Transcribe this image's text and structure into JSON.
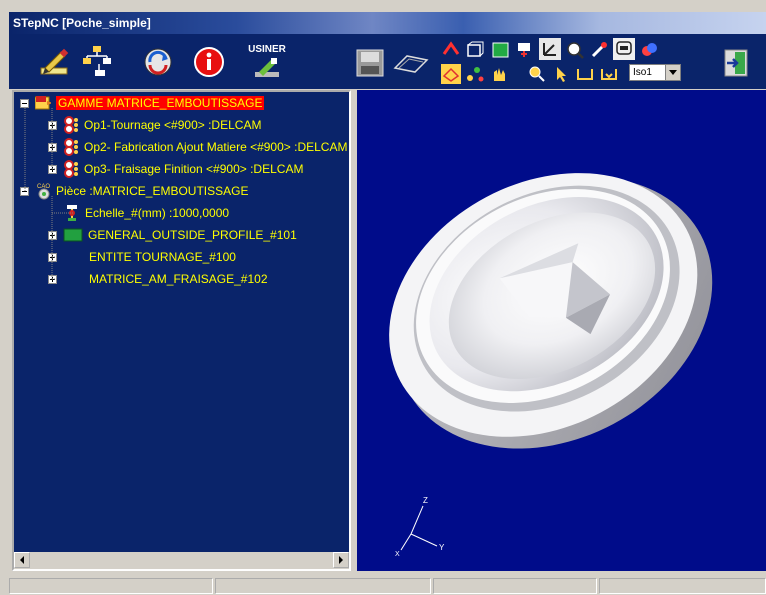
{
  "window": {
    "title": "STepNC [Poche_simple]"
  },
  "toolbar": {
    "usiner_label": "USINER",
    "view_select": {
      "value": "Iso1"
    },
    "icons": [
      "edit-pencil-icon",
      "tree-structure-icon",
      "refresh-icon",
      "info-icon",
      "machine-icon",
      "hard-disk-icon",
      "tool-path-icon",
      "view-rotate-icon",
      "view-zoom-icon",
      "view-fit-icon",
      "view-pan-icon",
      "exit-door-icon"
    ]
  },
  "tree": {
    "items": [
      {
        "label": "GAMME MATRICE_EMBOUTISSAGE",
        "expander": "minus",
        "icon": "stepnc-icon",
        "selected": true
      },
      {
        "label": "Op1-Tournage  <#900> :DELCAM",
        "expander": "plus",
        "icon": "operation-icon"
      },
      {
        "label": "Op2- Fabrication Ajout Matiere  <#900> :DELCAM",
        "expander": "plus",
        "icon": "operation-icon"
      },
      {
        "label": "Op3- Fraisage Finition <#900> :DELCAM",
        "expander": "plus",
        "icon": "operation-icon"
      },
      {
        "label": "Pièce :MATRICE_EMBOUTISSAGE",
        "expander": "minus",
        "icon": "cao-part-icon"
      },
      {
        "label": "Echelle_#(mm) :1000,0000",
        "expander": "none",
        "icon": "scale-icon"
      },
      {
        "label": "GENERAL_OUTSIDE_PROFILE_#101",
        "expander": "plus",
        "icon": "profile-icon"
      },
      {
        "label": "ENTITE TOURNAGE_#100",
        "expander": "plus",
        "icon": "none"
      },
      {
        "label": "MATRICE_AM_FRAISAGE_#102",
        "expander": "plus",
        "icon": "none"
      }
    ]
  },
  "viewport": {
    "background": "#000c8a",
    "axes": {
      "z": "Z",
      "y": "Y",
      "x": "X"
    }
  },
  "colors": {
    "tree_text": "#ffff00",
    "tree_bg": "#0a246a",
    "selection": "#ff0000"
  }
}
